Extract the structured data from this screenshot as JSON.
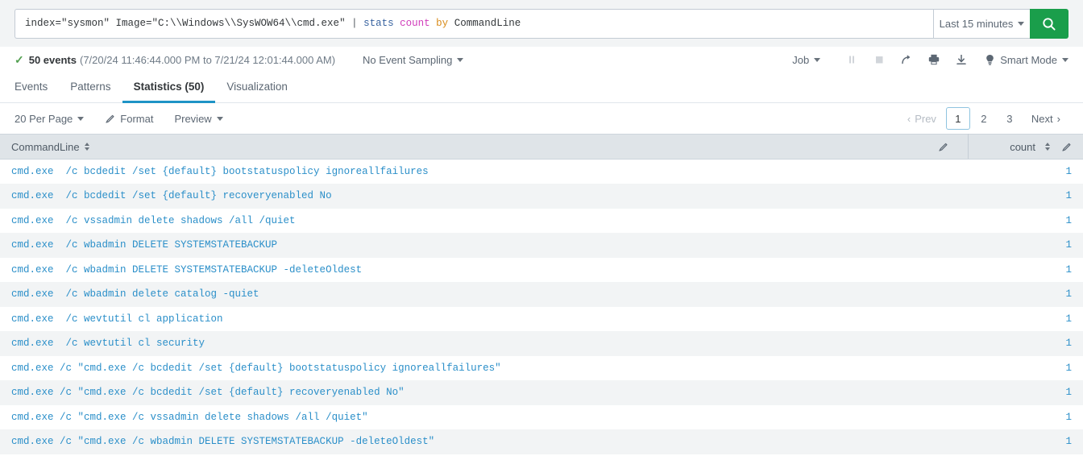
{
  "search": {
    "query_full": "index=\"sysmon\" Image=\"C:\\\\Windows\\\\SysWOW64\\\\cmd.exe\" | stats count by CommandLine",
    "tokens": {
      "base": "index=\"sysmon\" Image=\"C:\\\\Windows\\\\SysWOW64\\\\cmd.exe\" ",
      "pipe": "| ",
      "command": "stats",
      "space1": " ",
      "function": "count",
      "space2": " ",
      "keyword": "by",
      "space3": " ",
      "field": "CommandLine"
    },
    "time_range_label": "Last 15 minutes",
    "search_button_icon": "magnifier-icon",
    "search_button_color": "#1a9e4b"
  },
  "info_bar": {
    "status_icon": "check-icon",
    "event_count": "50 events",
    "time_span": "(7/20/24 11:46:44.000 PM to 7/21/24 12:01:44.000 AM)",
    "sampling_label": "No Event Sampling",
    "job_label": "Job",
    "controls": [
      {
        "name": "pause-button",
        "icon": "pause-icon",
        "disabled": true
      },
      {
        "name": "stop-button",
        "icon": "stop-icon",
        "disabled": true
      },
      {
        "name": "share-button",
        "icon": "share-arrow-icon",
        "disabled": false
      },
      {
        "name": "print-button",
        "icon": "printer-icon",
        "disabled": false
      },
      {
        "name": "export-button",
        "icon": "download-icon",
        "disabled": false
      }
    ],
    "mode_icon": "lightbulb-icon",
    "mode_label": "Smart Mode"
  },
  "tabs": [
    {
      "label": "Events",
      "active": false
    },
    {
      "label": "Patterns",
      "active": false
    },
    {
      "label": "Statistics (50)",
      "active": true
    },
    {
      "label": "Visualization",
      "active": false
    }
  ],
  "results_toolbar": {
    "per_page_label": "20 Per Page",
    "format_label": "Format",
    "format_icon": "pencil-icon",
    "preview_label": "Preview"
  },
  "pagination": {
    "prev_label": "Prev",
    "next_label": "Next",
    "pages": [
      "1",
      "2",
      "3"
    ],
    "active_page": "1"
  },
  "table": {
    "columns": [
      {
        "label": "CommandLine",
        "sortable": true,
        "edit_icon": "pencil-icon"
      },
      {
        "label": "count",
        "sortable": true,
        "edit_icon": "pencil-icon"
      }
    ],
    "rows": [
      {
        "CommandLine": "cmd.exe  /c bcdedit /set {default} bootstatuspolicy ignoreallfailures",
        "count": "1"
      },
      {
        "CommandLine": "cmd.exe  /c bcdedit /set {default} recoveryenabled No",
        "count": "1"
      },
      {
        "CommandLine": "cmd.exe  /c vssadmin delete shadows /all /quiet",
        "count": "1"
      },
      {
        "CommandLine": "cmd.exe  /c wbadmin DELETE SYSTEMSTATEBACKUP",
        "count": "1"
      },
      {
        "CommandLine": "cmd.exe  /c wbadmin DELETE SYSTEMSTATEBACKUP -deleteOldest",
        "count": "1"
      },
      {
        "CommandLine": "cmd.exe  /c wbadmin delete catalog -quiet",
        "count": "1"
      },
      {
        "CommandLine": "cmd.exe  /c wevtutil cl application",
        "count": "1"
      },
      {
        "CommandLine": "cmd.exe  /c wevtutil cl security",
        "count": "1"
      },
      {
        "CommandLine": "cmd.exe /c \"cmd.exe /c bcdedit /set {default} bootstatuspolicy ignoreallfailures\"",
        "count": "1"
      },
      {
        "CommandLine": "cmd.exe /c \"cmd.exe /c bcdedit /set {default} recoveryenabled No\"",
        "count": "1"
      },
      {
        "CommandLine": "cmd.exe /c \"cmd.exe /c vssadmin delete shadows /all /quiet\"",
        "count": "1"
      },
      {
        "CommandLine": "cmd.exe /c \"cmd.exe /c wbadmin DELETE SYSTEMSTATEBACKUP -deleteOldest\"",
        "count": "1"
      }
    ]
  },
  "colors": {
    "accent_blue": "#1e93c6",
    "link_blue": "#2b8fc9",
    "search_green": "#1a9e4b",
    "header_bg": "#dfe4e8",
    "stripe_bg": "#f2f4f5"
  }
}
